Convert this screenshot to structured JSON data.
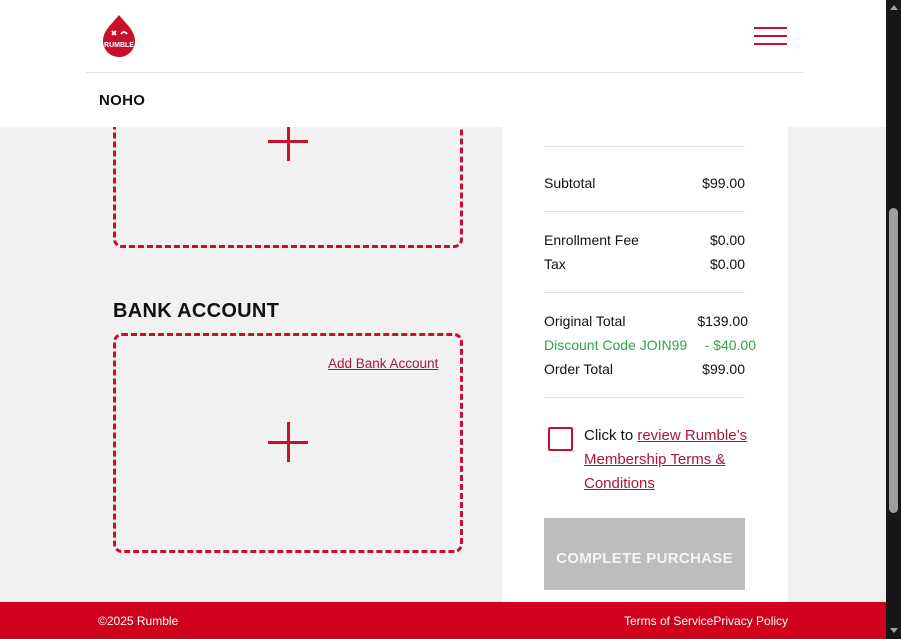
{
  "header": {
    "logo_text": "RUMBLE",
    "location": "NOHO"
  },
  "bank": {
    "title": "BANK ACCOUNT",
    "add_label": "Add Bank Account"
  },
  "summary": {
    "subtotal": {
      "label": "Subtotal",
      "value": "$99.00"
    },
    "enrollment_fee": {
      "label": "Enrollment Fee",
      "value": "$0.00"
    },
    "tax": {
      "label": "Tax",
      "value": "$0.00"
    },
    "original_total": {
      "label": "Original Total",
      "value": "$139.00"
    },
    "discount": {
      "label": "Discount Code JOIN99",
      "value": "- $40.00"
    },
    "order_total": {
      "label": "Order Total",
      "value": "$99.00"
    }
  },
  "terms": {
    "prefix": "Click to ",
    "link_text": "review Rumble’s Membership Terms & Conditions",
    "checked": false
  },
  "purchase_button": {
    "label": "COMPLETE PURCHASE",
    "enabled": false
  },
  "footer": {
    "copyright": "©2025 Rumble",
    "terms_of_service": "Terms of Service",
    "privacy_policy": "Privacy Policy"
  },
  "colors": {
    "brand_red": "#d0021b",
    "link_red": "#a8163a",
    "discount_green": "#2ea845",
    "disabled_button": "#bdbdbd"
  }
}
